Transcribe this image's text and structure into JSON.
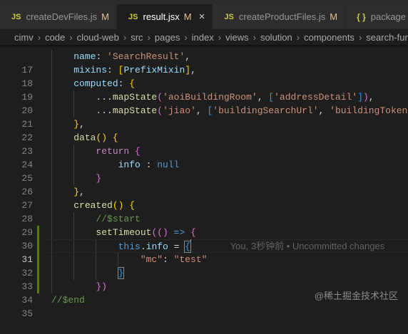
{
  "tabs": [
    {
      "icon": "JS",
      "name": "createDevFiles.js",
      "modified": "M",
      "active": false
    },
    {
      "icon": "JS",
      "name": "result.jsx",
      "modified": "M",
      "active": true,
      "close": "×"
    },
    {
      "icon": "JS",
      "name": "createProductFiles.js",
      "modified": "M",
      "active": false
    },
    {
      "icon": "{ }",
      "name": "package",
      "modified": "",
      "active": false
    }
  ],
  "breadcrumb": [
    "cimv",
    "code",
    "cloud-web",
    "src",
    "pages",
    "index",
    "views",
    "solution",
    "components",
    "search-func"
  ],
  "editor": {
    "line_numbers": [
      17,
      18,
      19,
      20,
      21,
      22,
      23,
      24,
      25,
      26,
      27,
      28,
      29,
      30,
      31,
      32,
      33,
      34,
      35
    ],
    "blame": "You, 3秒钟前 • Uncommitted changes"
  },
  "watermark": "@稀土掘金技术社区"
}
